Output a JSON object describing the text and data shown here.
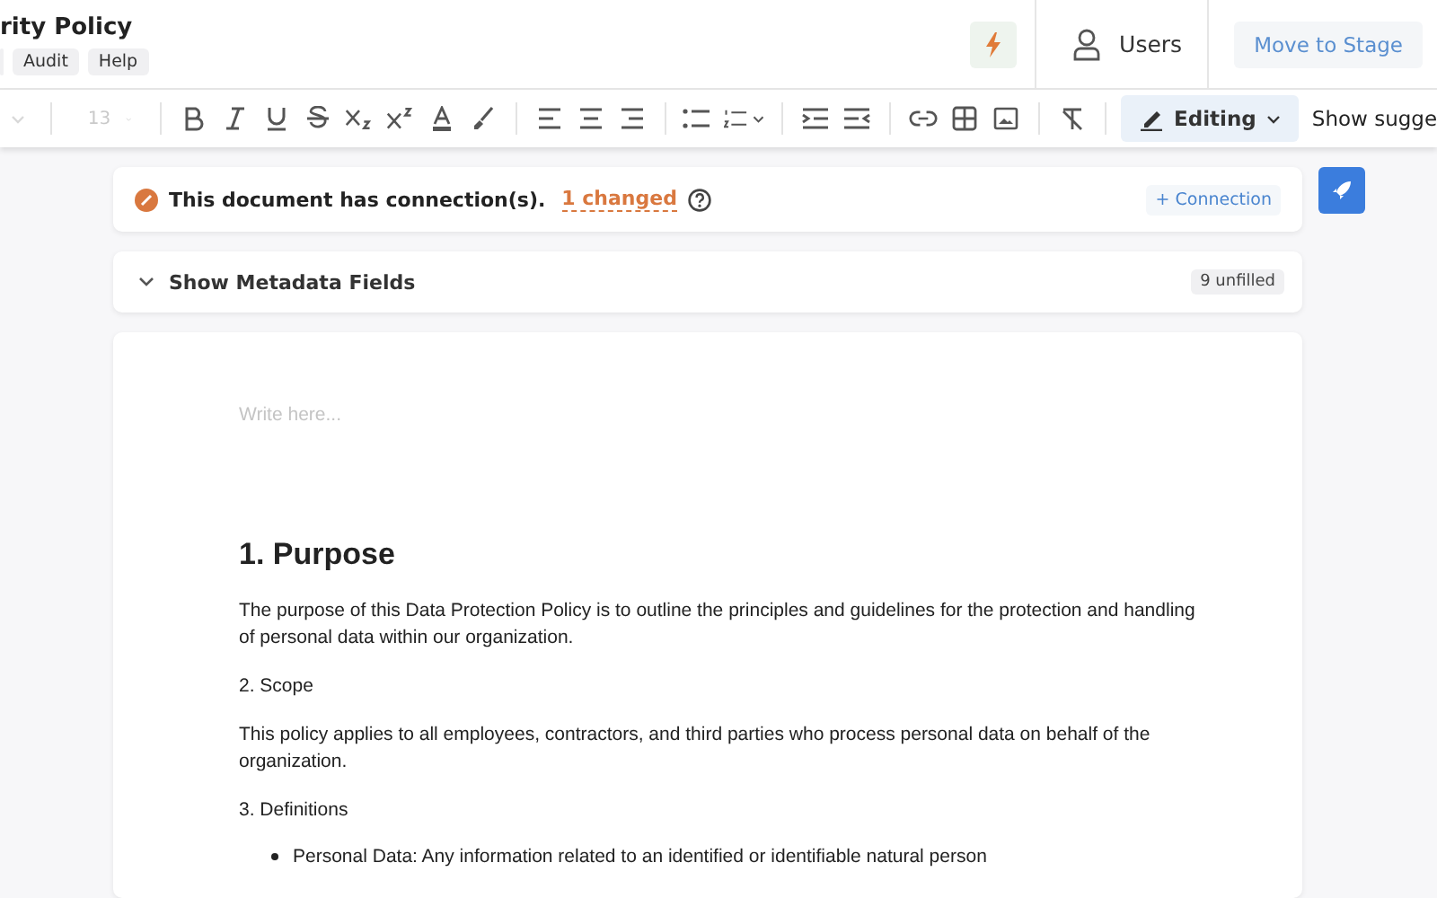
{
  "header": {
    "title": "rity Policy",
    "menu": [
      "Audit",
      "Help"
    ],
    "users_label": "Users",
    "stage_button": "Move to Stage"
  },
  "toolbar": {
    "font_size": "13",
    "font_disabled": true,
    "mode": "Editing",
    "suggestions": "Show sugge"
  },
  "connection": {
    "text": "This document has connection(s).",
    "changed": "1 changed",
    "add": "+ Connection"
  },
  "metadata": {
    "label": "Show Metadata Fields",
    "expanded": false,
    "badge": "9 unfilled"
  },
  "editor": {
    "placeholder": "Write here...",
    "blocks": [
      {
        "kind": "heading",
        "text": "1. Purpose"
      },
      {
        "kind": "paragraph",
        "text": "The purpose of this Data Protection Policy is to outline the principles and guidelines for the protection and handling of personal data within our organization."
      },
      {
        "kind": "paragraph",
        "text": "2. Scope"
      },
      {
        "kind": "paragraph",
        "text": "This policy applies to all employees, contractors, and third parties who process personal data on behalf of the organization."
      },
      {
        "kind": "paragraph",
        "text": "3. Definitions"
      },
      {
        "kind": "bullet",
        "text": "Personal Data: Any information related to an identified or identifiable natural person"
      }
    ]
  }
}
